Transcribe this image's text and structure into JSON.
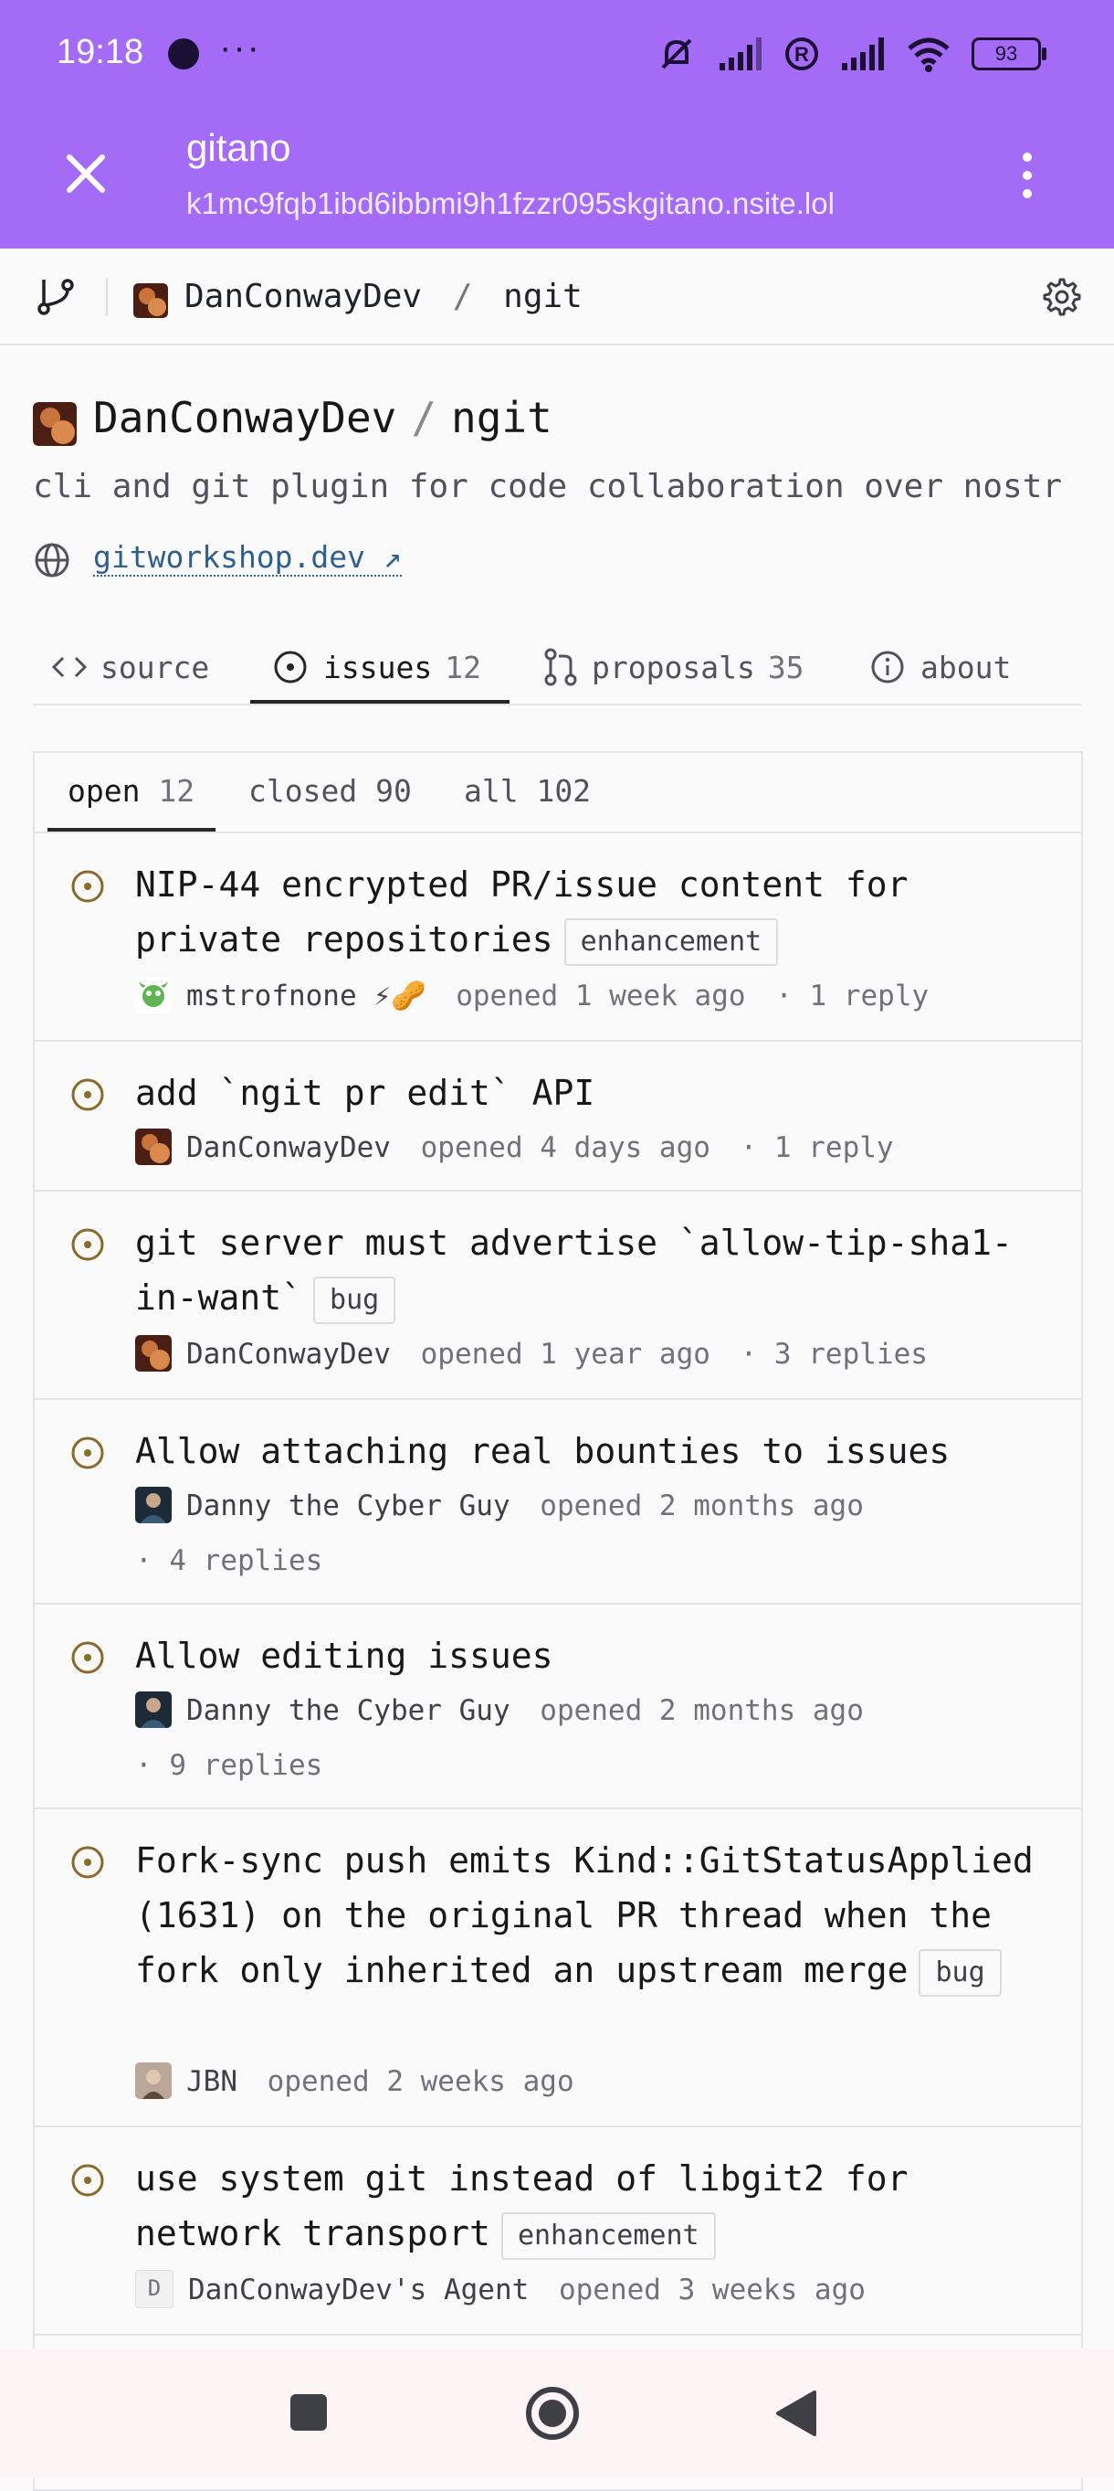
{
  "status_bar": {
    "time": "19:18",
    "more": "···",
    "battery": "93"
  },
  "browser": {
    "title": "gitano",
    "url": "k1mc9fqb1ibd6ibbmi9h1fzzr095skgitano.nsite.lol"
  },
  "header": {
    "owner": "DanConwayDev",
    "separator": "/",
    "repo": "ngit"
  },
  "repo": {
    "owner": "DanConwayDev",
    "separator": "/",
    "name": "ngit",
    "description": "cli and git plugin for code collaboration over nostr",
    "link": "gitworkshop.dev",
    "link_arrow": "↗"
  },
  "tabs": [
    {
      "label": "source",
      "count": ""
    },
    {
      "label": "issues",
      "count": "12"
    },
    {
      "label": "proposals",
      "count": "35"
    },
    {
      "label": "about",
      "count": ""
    }
  ],
  "subtabs": [
    {
      "label": "open",
      "count": "12"
    },
    {
      "label": "closed",
      "count": "90"
    },
    {
      "label": "all",
      "count": "102"
    }
  ],
  "issues": [
    {
      "title": "NIP-44 encrypted PR/issue content for private repositories",
      "label": "enhancement",
      "author": "mstrofnone ⚡🥜",
      "opened": "opened 1 week ago",
      "replies": "· 1 reply"
    },
    {
      "title": "add `ngit pr edit` API",
      "label": "",
      "author": "DanConwayDev",
      "opened": "opened 4 days ago",
      "replies": "· 1 reply"
    },
    {
      "title": "git server must advertise `allow-tip-sha1-in-want`",
      "label": "bug",
      "author": "DanConwayDev",
      "opened": "opened 1 year ago",
      "replies": "· 3 replies"
    },
    {
      "title": "Allow attaching real bounties to issues",
      "label": "",
      "author": "Danny the Cyber Guy",
      "opened": "opened 2 months ago",
      "replies": "· 4 replies"
    },
    {
      "title": "Allow editing issues",
      "label": "",
      "author": "Danny the Cyber Guy",
      "opened": "opened 2 months ago",
      "replies": "· 9 replies"
    },
    {
      "title": "Fork-sync push emits Kind::GitStatusApplied (1631) on the original PR thread when the fork only inherited an upstream merge",
      "label": "bug",
      "author": "JBN",
      "opened": "opened 2 weeks ago",
      "replies": ""
    },
    {
      "title": "use system git instead of libgit2 for network transport",
      "label": "enhancement",
      "author": "DanConwayDev's Agent",
      "avatar_letter": "D",
      "opened": "opened 3 weeks ago",
      "replies": ""
    }
  ],
  "icons": {
    "close": "close-icon",
    "menu": "more-vert-icon",
    "branch": "git-branch-icon",
    "settings": "gear-icon",
    "globe": "globe-icon",
    "source": "code-icon",
    "issues": "issue-open-icon",
    "proposals": "pull-request-icon",
    "about": "info-icon",
    "nav_recents": "square-icon",
    "nav_home": "circle-icon",
    "nav_back": "triangle-back-icon"
  },
  "colors": {
    "accent_bar": "#a46cf6",
    "issue_open": "#8a6a2a",
    "link": "#2f5f91"
  }
}
